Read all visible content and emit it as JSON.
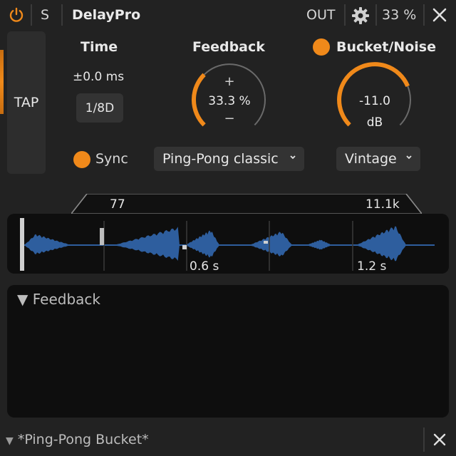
{
  "header": {
    "solo_label": "S",
    "app_title": "DelayPro",
    "output_label": "OUT",
    "zoom_label": "33 %",
    "accent_color": "#f0891a"
  },
  "tap": {
    "label": "TAP"
  },
  "time": {
    "title": "Time",
    "offset_value": "±0.0 ms",
    "note_value": "1/8D",
    "sync_label": "Sync"
  },
  "feedback": {
    "title": "Feedback",
    "plus": "+",
    "value": "33.3 %",
    "minus": "−",
    "level": 0.333,
    "mode_value": "Ping-Pong classic"
  },
  "bucket": {
    "title": "Bucket/Noise",
    "value": "-11.0",
    "unit": "dB",
    "level": 0.75,
    "character_value": "Vintage"
  },
  "filter_range": {
    "low": "77",
    "high": "11.1k"
  },
  "waveform": {
    "color": "#2e5e9e",
    "time_markers": [
      "0.6 s",
      "1.2 s"
    ]
  },
  "feedback_panel": {
    "title": "Feedback"
  },
  "footer": {
    "preset_name": "*Ping-Pong Bucket*"
  }
}
